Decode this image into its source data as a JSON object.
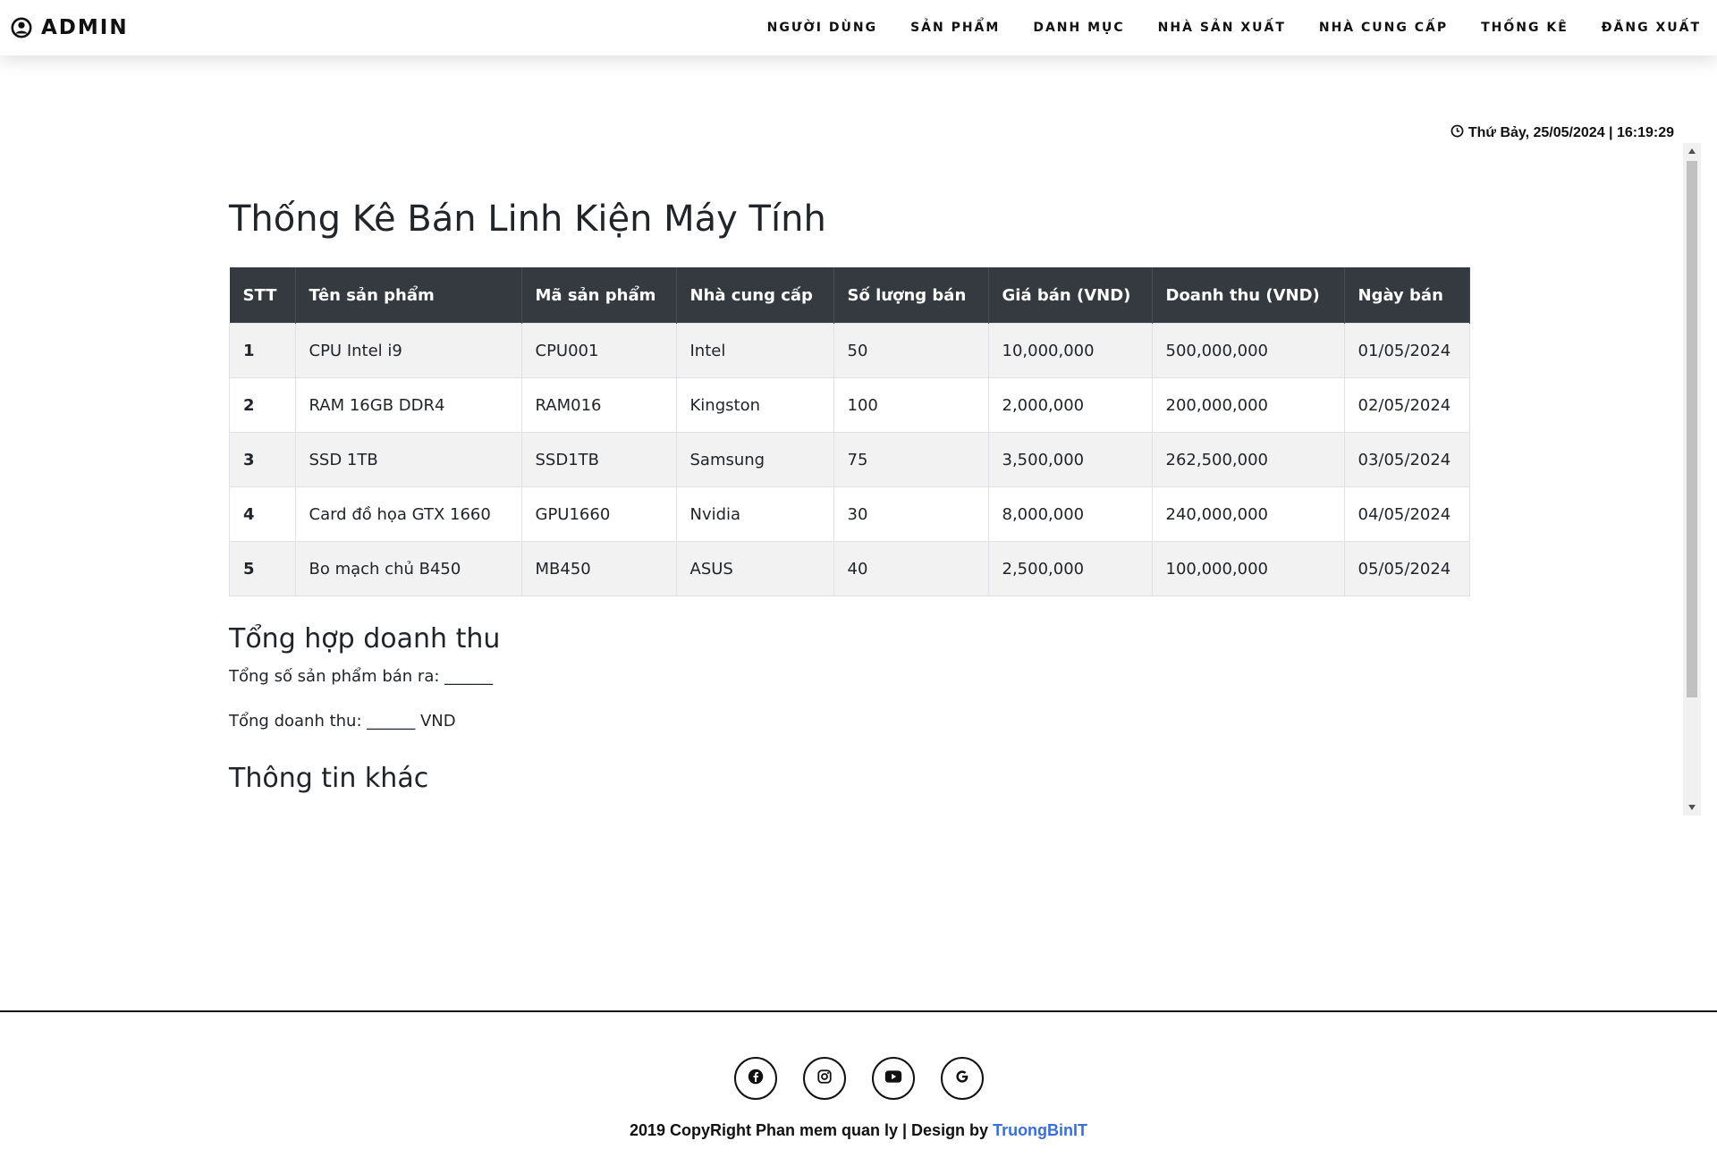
{
  "header": {
    "brand": "ADMIN",
    "nav": [
      {
        "label": "NGƯỜI DÙNG"
      },
      {
        "label": "SẢN PHẨM"
      },
      {
        "label": "DANH MỤC"
      },
      {
        "label": "NHÀ SẢN XUẤT"
      },
      {
        "label": "NHÀ CUNG CẤP"
      },
      {
        "label": "THỐNG KÊ"
      },
      {
        "label": "ĐĂNG XUẤT"
      }
    ]
  },
  "datetime": "Thứ Bảy, 25/05/2024 | 16:19:29",
  "main": {
    "title": "Thống Kê Bán Linh Kiện Máy Tính",
    "table": {
      "headers": [
        "STT",
        "Tên sản phẩm",
        "Mã sản phẩm",
        "Nhà cung cấp",
        "Số lượng bán",
        "Giá bán (VND)",
        "Doanh thu (VND)",
        "Ngày bán"
      ],
      "rows": [
        [
          "1",
          "CPU Intel i9",
          "CPU001",
          "Intel",
          "50",
          "10,000,000",
          "500,000,000",
          "01/05/2024"
        ],
        [
          "2",
          "RAM 16GB DDR4",
          "RAM016",
          "Kingston",
          "100",
          "2,000,000",
          "200,000,000",
          "02/05/2024"
        ],
        [
          "3",
          "SSD 1TB",
          "SSD1TB",
          "Samsung",
          "75",
          "3,500,000",
          "262,500,000",
          "03/05/2024"
        ],
        [
          "4",
          "Card đồ họa GTX 1660",
          "GPU1660",
          "Nvidia",
          "30",
          "8,000,000",
          "240,000,000",
          "04/05/2024"
        ],
        [
          "5",
          "Bo mạch chủ B450",
          "MB450",
          "ASUS",
          "40",
          "2,500,000",
          "100,000,000",
          "05/05/2024"
        ]
      ]
    },
    "summary": {
      "title": "Tổng hợp doanh thu",
      "total_products": "Tổng số sản phẩm bán ra: ______",
      "total_revenue": "Tổng doanh thu: ______ VND"
    },
    "other": {
      "title": "Thông tin khác"
    }
  },
  "footer": {
    "socials": [
      {
        "icon": "facebook-icon"
      },
      {
        "icon": "instagram-icon"
      },
      {
        "icon": "youtube-icon"
      },
      {
        "icon": "google-icon"
      }
    ],
    "copyright_text": "2019 CopyRight Phan mem quan ly | Design by ",
    "author": "TruongBinIT"
  }
}
